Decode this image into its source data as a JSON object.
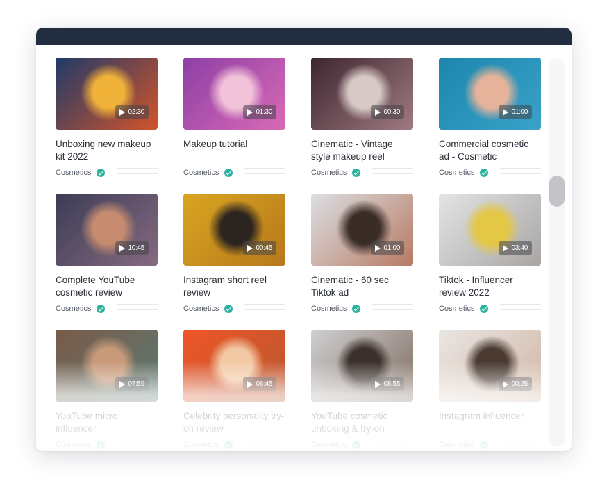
{
  "window": {
    "titlebar_color": "#232d40"
  },
  "videos": [
    {
      "title": "Unboxing new makeup kit 2022",
      "duration": "02:30",
      "category": "Cosmetics",
      "verified": true,
      "thumb_colors": [
        "#1f3a68",
        "#d2542a",
        "#f1b23a"
      ]
    },
    {
      "title": "Makeup tutorial",
      "duration": "01:30",
      "category": "Cosmetics",
      "verified": true,
      "thumb_colors": [
        "#8d3fa6",
        "#d96ab5",
        "#f2c2d9"
      ]
    },
    {
      "title": "Cinematic - Vintage style makeup reel",
      "duration": "00:30",
      "category": "Cosmetics",
      "verified": true,
      "thumb_colors": [
        "#3d2630",
        "#a07a80",
        "#d8c9c6"
      ]
    },
    {
      "title": "Commercial cosmetic ad - Cosmetic",
      "duration": "01:00",
      "category": "Cosmetics",
      "verified": true,
      "thumb_colors": [
        "#1d86ad",
        "#3aa2c8",
        "#e6b39a"
      ]
    },
    {
      "title": "Complete YouTube cosmetic review",
      "duration": "10:45",
      "category": "Cosmetics",
      "verified": true,
      "thumb_colors": [
        "#3b3c55",
        "#866a80",
        "#c78c6f"
      ]
    },
    {
      "title": "Instagram short reel review",
      "duration": "00:45",
      "category": "Cosmetics",
      "verified": true,
      "thumb_colors": [
        "#d9a521",
        "#b7781b",
        "#2b2420"
      ]
    },
    {
      "title": "Cinematic - 60 sec Tiktok ad",
      "duration": "01:00",
      "category": "Cosmetics",
      "verified": true,
      "thumb_colors": [
        "#dcdfe4",
        "#b77a62",
        "#3a2c26"
      ]
    },
    {
      "title": "Tiktok - Influencer review 2022",
      "duration": "03:40",
      "category": "Cosmetics",
      "verified": true,
      "thumb_colors": [
        "#e2e4e6",
        "#a9a6a3",
        "#e4c744"
      ]
    },
    {
      "title": "YouTube micro influencer",
      "duration": "07:59",
      "category": "Cosmetics",
      "verified": true,
      "thumb_colors": [
        "#7a5a48",
        "#5c7a72",
        "#c89a7a"
      ]
    },
    {
      "title": "Celebrity personality try-on review",
      "duration": "06:45",
      "category": "Cosmetics",
      "verified": true,
      "thumb_colors": [
        "#ef5628",
        "#b9572f",
        "#f3c9a5"
      ]
    },
    {
      "title": "YouTube cosmetic unboxing & try-on",
      "duration": "08:55",
      "category": "Cosmetics",
      "verified": true,
      "thumb_colors": [
        "#cfd0d2",
        "#7f6a5e",
        "#3b302b"
      ]
    },
    {
      "title": "Instagram influencer",
      "duration": "00:25",
      "category": "Cosmetics",
      "verified": true,
      "thumb_colors": [
        "#e9e6e3",
        "#d0b5a3",
        "#4a3a32"
      ]
    }
  ],
  "colors": {
    "verified": "#2fb3a3",
    "scrollbar_thumb": "#c2c4c7"
  }
}
